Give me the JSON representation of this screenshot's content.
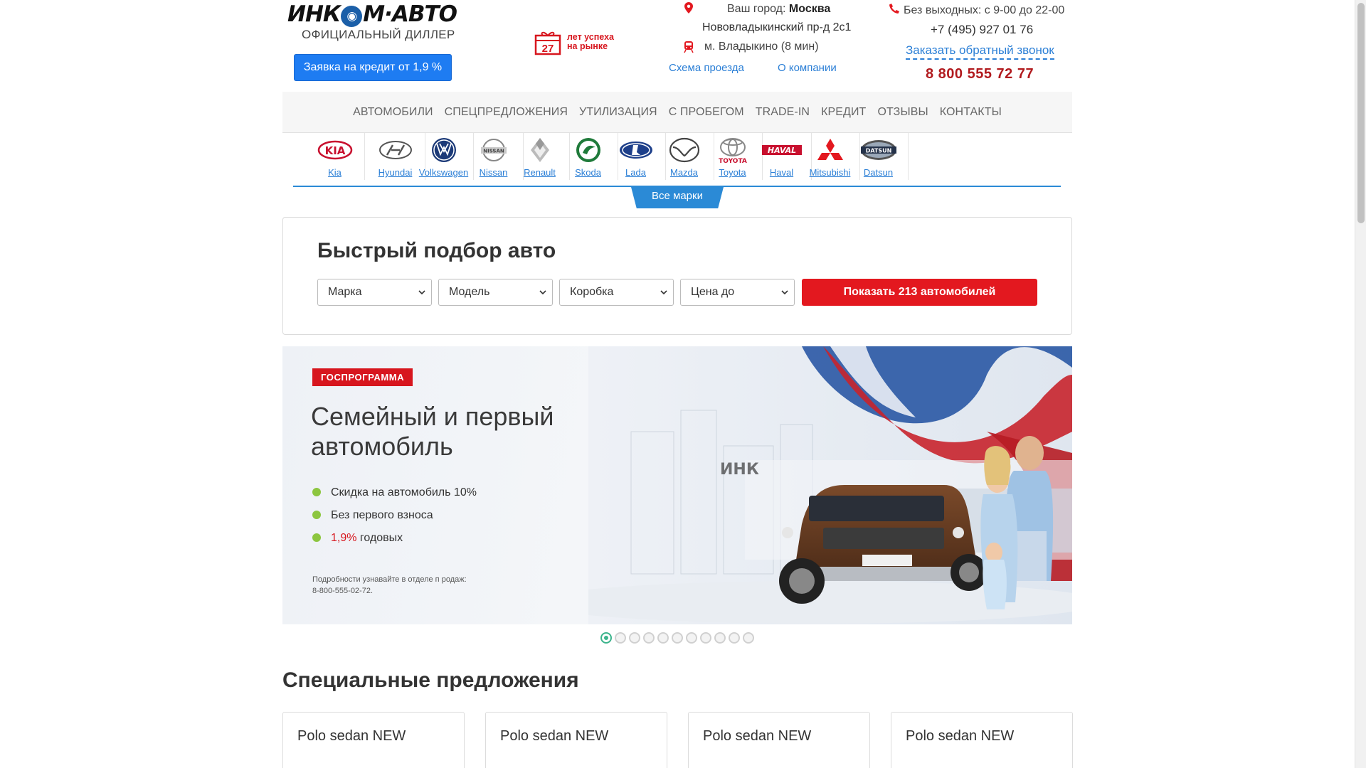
{
  "header": {
    "logo": {
      "left": "ИНК",
      "o": "◉",
      "right": "М·АВТО"
    },
    "dealer": "ОФИЦИАЛЬНЫЙ ДИЛЛЕР",
    "credit_button": "Заявка на кредит от 1,9 %",
    "years": {
      "number": "27",
      "text": "лет успеха на рынке"
    },
    "city_label": "Ваш город:",
    "city": "Москва",
    "address": "Нововладыкинский пр-д 2с1",
    "metro": "м. Владыкино (8 мин)",
    "route_link": "Схема проезда",
    "about_link": "О компании",
    "hours": "Без выходных: с 9-00 до 22-00",
    "phone1": "+7 (495) 927 01 76",
    "callback": "Заказать обратный звонок",
    "phone2": "8 800 555 72 77"
  },
  "nav": {
    "items": [
      "АВТОМОБИЛИ",
      "СПЕЦПРЕДЛОЖЕНИЯ",
      "УТИЛИЗАЦИЯ",
      "С ПРОБЕГОМ",
      "TRADE-IN",
      "КРЕДИТ",
      "ОТЗЫВЫ",
      "КОНТАКТЫ"
    ]
  },
  "brands": {
    "items": [
      "Kia",
      "Hyundai",
      "Volkswagen",
      "Nissan",
      "Renault",
      "Skoda",
      "Lada",
      "Mazda",
      "Toyota",
      "Haval",
      "Mitsubishi",
      "Datsun"
    ],
    "logo_text": {
      "kia": "KIA",
      "nissan": "NISSAN",
      "toyota": "TOYOTA",
      "haval": "HAVAL",
      "datsun": "DATSUN"
    },
    "all_brands": "Все марки"
  },
  "quick_search": {
    "title": "Быстрый подбор авто",
    "selects": [
      "Марка",
      "Модель",
      "Коробка",
      "Цена до"
    ],
    "button": "Показать 213 автомобилей"
  },
  "banner": {
    "tag": "ГОСПРОГРАММА",
    "title_line1": "Семейный и первый",
    "title_line2": "автомобиль",
    "bullets": [
      "Скидка на автомобиль 10%",
      "Без первого взноса"
    ],
    "bullet3_red": "1,9%",
    "bullet3_rest": " годовых",
    "fine_line1": "Подробности узнавайте в отделе п родаж:",
    "fine_line2": "8-800-555-02-72.",
    "building_sign": "ИНК"
  },
  "slider": {
    "count": 11,
    "active": 0
  },
  "special_offers": {
    "title": "Специальные предложения",
    "cards": [
      "Polo sedan NEW",
      "Polo sedan NEW",
      "Polo sedan NEW",
      "Polo sedan NEW"
    ]
  },
  "colors": {
    "accent_blue": "#1e7cf2",
    "brand_red": "#d7161e",
    "link_blue": "#2b7fd6",
    "nav_underline": "#2b8ad6",
    "slider_active": "#3cb48c"
  }
}
